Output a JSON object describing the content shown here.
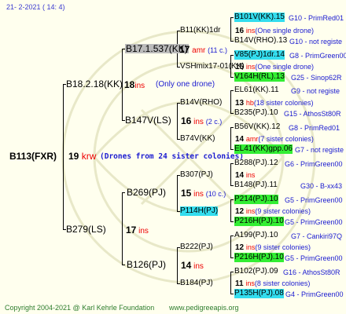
{
  "header": {
    "date": "21-   2-2021  ( 14:   4)"
  },
  "root": {
    "id": "B113(FXR)",
    "ins": "19",
    "mark": "krw",
    "note": "(Drones from 24 sister colonies)"
  },
  "gen1": [
    {
      "id": "B18.2.18(KK)",
      "ins": "18",
      "mark": "ins",
      "note": "(Only one drone)"
    },
    {
      "id": "B279(LS)",
      "ins": "17",
      "mark": "ins"
    }
  ],
  "gen2": [
    {
      "id": "B17.1.537(KK)",
      "ins": "17",
      "mark": "amr",
      "note": "(11 c.)"
    },
    {
      "id": "B147V(LS)",
      "ins": "16",
      "mark": "ins",
      "note": "(2 c.)"
    },
    {
      "id": "B269(PJ)",
      "ins": "15",
      "mark": "ins",
      "note": "(10 c.)"
    },
    {
      "id": "B126(PJ)",
      "ins": "14",
      "mark": "ins"
    }
  ],
  "gen3": [
    {
      "id": "B11(KK)1dr",
      "ins": "16",
      "mark": "ins",
      "note": "(One single drone)"
    },
    {
      "id": "VSHmix17-01(KK)",
      "ins": "15",
      "mark": "ins",
      "note": "(One single drone)"
    },
    {
      "id": "B14V(RHO)",
      "ins": "13",
      "mark": "hb",
      "note": "(18 sister colonies)"
    },
    {
      "id": "B74V(KK)",
      "ins": "14",
      "mark": "amr",
      "note": "(7 sister colonies)"
    },
    {
      "id": "B307(PJ)",
      "ins": "14",
      "mark": "ins"
    },
    {
      "id": "P114H(PJ)",
      "ins": "12",
      "mark": "ins",
      "note": "(9 sister colonies)"
    },
    {
      "id": "B222(PJ)",
      "ins": "12",
      "mark": "ins",
      "note": "(9 sister colonies)"
    },
    {
      "id": "B184(PJ)",
      "ins": "11",
      "mark": "ins",
      "note": "(8 sister colonies)"
    }
  ],
  "gen4": [
    {
      "id": "B101V(KK).15",
      "gen": "G10 - PrimRed01"
    },
    {
      "id": "B14V(RHO).13",
      "gen": "G10 - not registe"
    },
    {
      "id": "V85(PJ)1dr.14",
      "gen": "G8 - PrimGreen00"
    },
    {
      "id": "V164H(RL).13",
      "gen": "G25 - Sinop62R"
    },
    {
      "id": "EL61(KK).11",
      "gen": "G9 - not registe"
    },
    {
      "id": "B235(PJ).10",
      "gen": "G15 - AthosSt80R"
    },
    {
      "id": "B56V(KK).12",
      "gen": "G8 - PrimRed01"
    },
    {
      "id": "EL41(KK)gpp.06",
      "gen": "G7 - not registe"
    },
    {
      "id": "B288(PJ).12",
      "gen": "G6 - PrimGreen00"
    },
    {
      "id": "B148(PJ).11",
      "gen": "G30 - B-xx43"
    },
    {
      "id": "P214(PJ).10",
      "gen": "G5 - PrimGreen00"
    },
    {
      "id": "P216H(PJ).10",
      "gen": "G5 - PrimGreen00"
    },
    {
      "id": "A199(PJ).10",
      "gen": "G7 - Cankiri97Q"
    },
    {
      "id": "P216H(PJ).10",
      "gen": "G5 - PrimGreen00"
    },
    {
      "id": "B102(PJ).09",
      "gen": "G16 - AthosSt80R"
    },
    {
      "id": "P135H(PJ).08",
      "gen": "G4 - PrimGreen00"
    }
  ],
  "footer": {
    "copyright": "Copyright 2004-2021 @ Karl Kehrle Foundation",
    "site": "www.pedigreeapis.org"
  }
}
